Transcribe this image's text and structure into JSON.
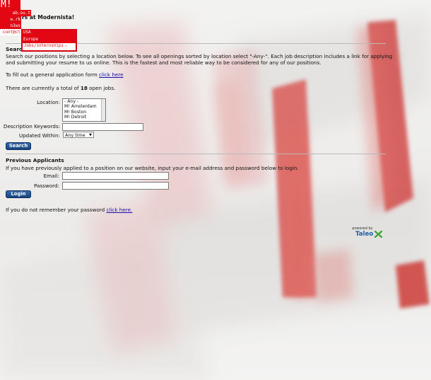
{
  "nav": {
    "logo": "M!",
    "items": [
      {
        "label": "ab.ou.t"
      },
      {
        "label": "w.rk"
      },
      {
        "label": "n3ws"
      },
      {
        "label": "cont@ct"
      }
    ],
    "submenu": [
      {
        "label": "USA",
        "external": ""
      },
      {
        "label": "Europe",
        "external": ""
      },
      {
        "label": "Jobs/internships",
        "external": "↗"
      }
    ]
  },
  "page": {
    "title": "rs at Modernista!"
  },
  "search_section": {
    "title": "Searc",
    "intro_line1": "Search our positions by selecting a location below. To see all openings sorted by location select \"-Any-\". Each job description includes a link for applying",
    "intro_line2": "and submitting your resume to us online. This is the fastest and most reliable way to be considered for any of our positions.",
    "general_app_text": "To fill out a general application form ",
    "general_app_link": "click here",
    "open_jobs_prefix": "There are currently a total of ",
    "open_jobs_count": "18",
    "open_jobs_suffix": " open jobs.",
    "location_label": "Location:",
    "location_options": [
      "- Any -",
      "M! Amsterdam",
      "M! Boston",
      "M! Detroit"
    ],
    "keywords_label": "Description Keywords:",
    "keywords_value": "",
    "updated_label": "Updated Within:",
    "updated_value": "Any time",
    "search_button": "Search"
  },
  "login_section": {
    "title": "Previous Applicants",
    "intro": "If you have previously applied to a position on our website, input your e-mail address and password below to login.",
    "email_label": "Email:",
    "email_value": "",
    "password_label": "Password:",
    "password_value": "",
    "login_button": "Login",
    "forgot_text": "If you do not remember your password ",
    "forgot_link": "click here."
  },
  "footer": {
    "powered_by": "powered by",
    "brand": "Taleo"
  },
  "colors": {
    "brand_red": "#e30613",
    "button_blue": "#1f4f8f",
    "link_blue": "#1a0dab",
    "taleo_blue": "#1f5fa8",
    "taleo_green": "#3fa535"
  }
}
